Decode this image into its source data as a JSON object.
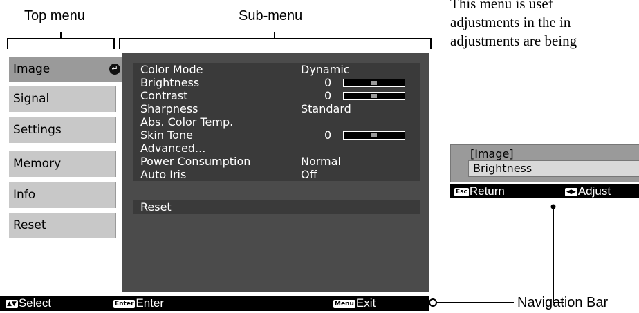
{
  "labels": {
    "top_menu": "Top menu",
    "sub_menu": "Sub-menu",
    "navigation_bar": "Navigation Bar"
  },
  "top_menu": [
    {
      "label": "Image",
      "active": true
    },
    {
      "label": "Signal"
    },
    {
      "label": "Settings"
    },
    {
      "label": "Memory"
    },
    {
      "label": "Info"
    },
    {
      "label": "Reset"
    }
  ],
  "sub_menu": {
    "rows": [
      {
        "label": "Color Mode",
        "value": "Dynamic"
      },
      {
        "label": "Brightness",
        "value": "0",
        "slider": 0.5
      },
      {
        "label": "Contrast",
        "value": "0",
        "slider": 0.5
      },
      {
        "label": "Sharpness",
        "value": "Standard"
      },
      {
        "label": "Abs. Color Temp.",
        "value": ""
      },
      {
        "label": "Skin Tone",
        "value": "0",
        "slider": 0.5
      },
      {
        "label": "Advanced...",
        "value": ""
      },
      {
        "label": "Power Consumption",
        "value": "Normal"
      },
      {
        "label": "Auto Iris",
        "value": "Off"
      }
    ],
    "reset": "Reset"
  },
  "nav_bar": {
    "select_key": "▲▼",
    "select": "Select",
    "enter_key": "Enter",
    "enter": "Enter",
    "menu_key": "Menu",
    "exit": "Exit"
  },
  "paragraph": {
    "line1": "This  menu  is  usef",
    "line2": "adjustments in the in",
    "line3": "adjustments are being"
  },
  "mini_menu": {
    "header": "[Image]",
    "selected": "Brightness",
    "nav_return_key": "Esc",
    "nav_return": "Return",
    "nav_adjust_key": "◀▶",
    "nav_adjust": "Adjust"
  }
}
